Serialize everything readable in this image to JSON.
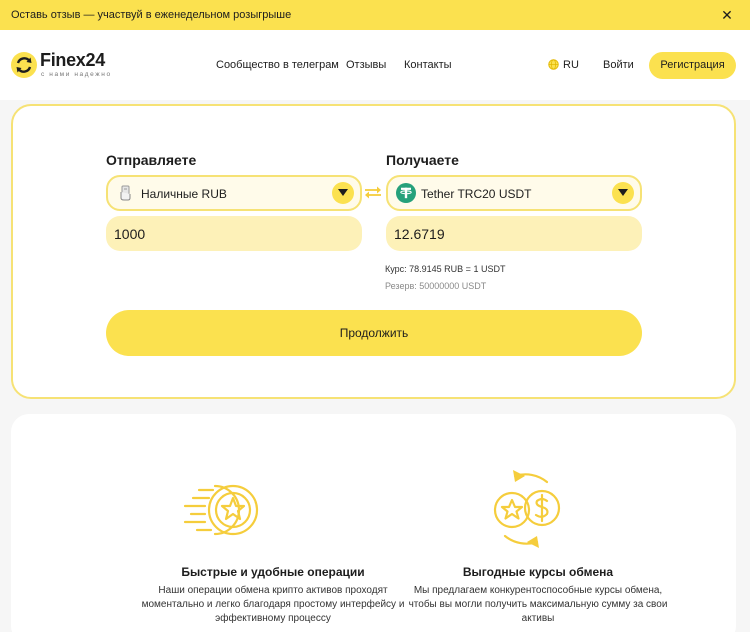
{
  "banner": {
    "text": "Оставь отзыв — участвуй в еженедельном розыгрыше",
    "close_icon": "close-icon"
  },
  "header": {
    "logo": {
      "name": "Finex24",
      "tagline": "с нами надежно"
    },
    "nav": [
      "Сообщество в телеграм",
      "Отзывы",
      "Контакты"
    ],
    "language": "RU",
    "login_label": "Войти",
    "register_label": "Регистрация"
  },
  "exchange": {
    "send": {
      "title": "Отправляете",
      "currency": "Наличные RUB",
      "currency_icon": "cash-icon",
      "amount": "1000"
    },
    "receive": {
      "title": "Получаете",
      "currency": "Tether TRC20 USDT",
      "currency_icon": "tether-icon",
      "amount": "12.6719"
    },
    "rate": "Курс: 78.9145 RUB = 1 USDT",
    "reserve": "Резерв: 50000000 USDT",
    "continue_label": "Продолжить"
  },
  "features": [
    {
      "icon": "fast-star-coin-icon",
      "title": "Быстрые и удобные операции",
      "lines": [
        "Наши операции обмена крипто активов проходят",
        "моментально и легко благодаря простому интерфейсу и",
        "эффективному процессу"
      ]
    },
    {
      "icon": "exchange-coins-icon",
      "title": "Выгодные курсы обмена",
      "lines": [
        "Мы предлагаем конкурентоспособные курсы обмена,",
        "чтобы вы могли получить максимальную сумму за свои",
        "активы"
      ]
    }
  ],
  "colors": {
    "accent": "#fbe14f",
    "accent_light": "#fdf1b8",
    "tether": "#26a17b",
    "text": "#1d1d1d"
  }
}
